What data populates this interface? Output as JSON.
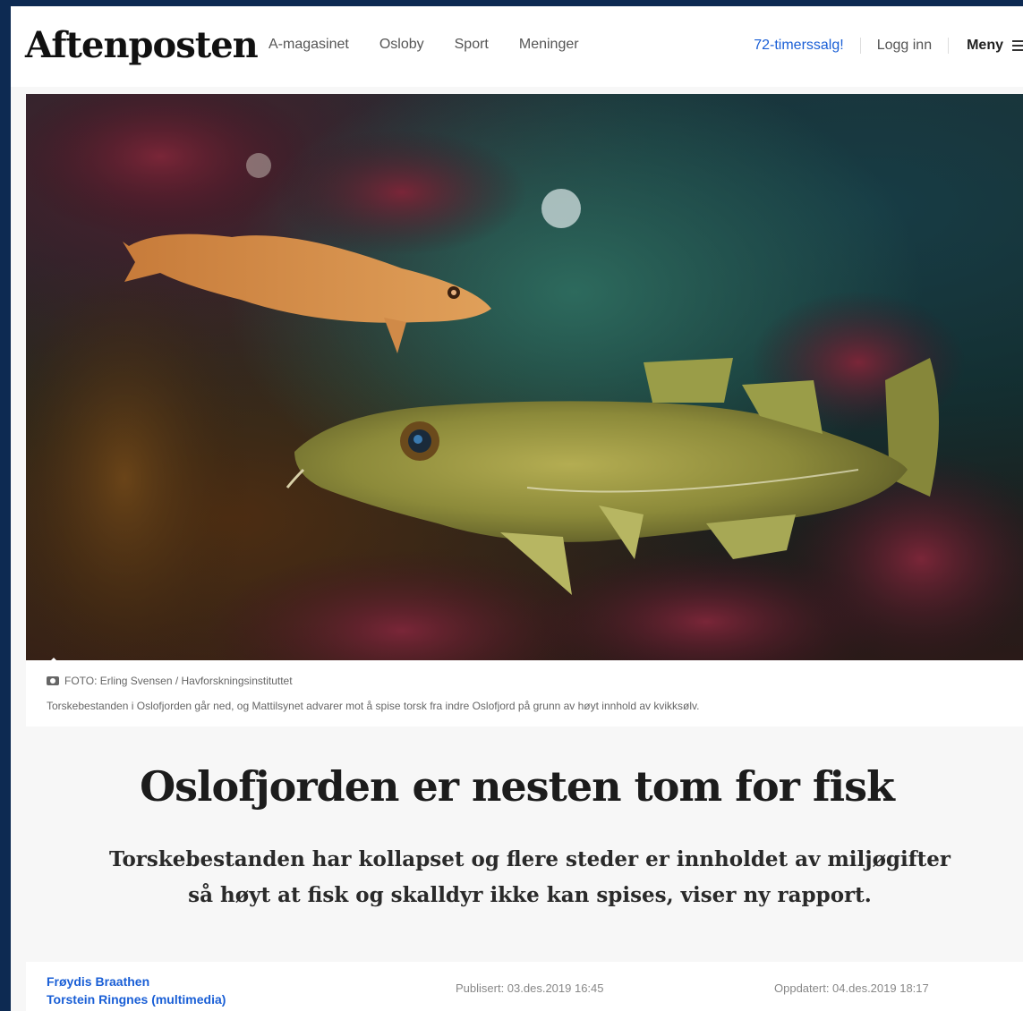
{
  "header": {
    "logo": "Aftenposten",
    "nav": [
      "A-magasinet",
      "Osloby",
      "Sport",
      "Meninger"
    ],
    "sale_link": "72-timerssalg!",
    "login": "Logg inn",
    "menu": "Meny"
  },
  "hero": {
    "photo_credit": "FOTO: Erling Svensen / Havforskningsinstituttet",
    "caption": "Torskebestanden i Oslofjorden går ned, og Mattilsynet advarer mot å spise torsk fra indre Oslofjord på grunn av høyt innhold av kvikksølv."
  },
  "article": {
    "title": "Oslofjorden er nesten tom for fisk",
    "lead": "Torskebestanden har kollapset og flere steder er innholdet av miljøgifter så høyt at fisk og skalldyr ikke kan spises, viser ny rapport."
  },
  "byline": {
    "authors": [
      "Frøydis Braathen",
      "Torstein Ringnes (multimedia)"
    ],
    "published": "Publisert: 03.des.2019 16:45",
    "updated": "Oppdatert: 04.des.2019 18:17"
  },
  "icons": {
    "camera": "camera-icon",
    "menu": "hamburger-icon"
  },
  "colors": {
    "accent_link": "#1a5fd6",
    "frame": "#0d2a52"
  }
}
